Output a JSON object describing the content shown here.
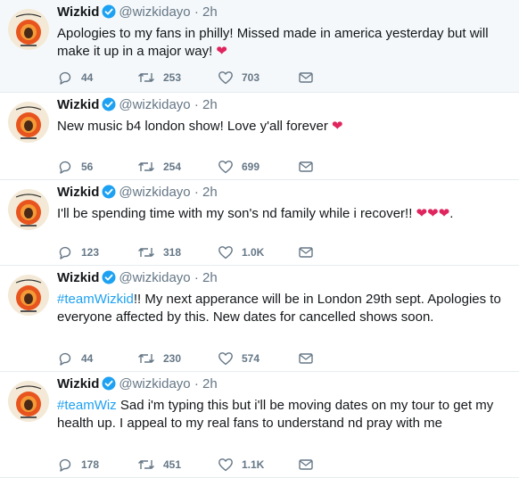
{
  "colors": {
    "link": "#1da1f2",
    "heart": "#e0245e",
    "muted": "#657786",
    "verified": "#1da1f2"
  },
  "tweets": [
    {
      "name": "Wizkid",
      "handle": "@wizkidayo",
      "sep": "·",
      "time": "2h",
      "hashtag": "",
      "text": "Apologies to my fans in philly! Missed made in america yesterday but will make it up in a major way! ",
      "emoji": "❤",
      "trailing": "",
      "reply_icon": "reply-icon",
      "retweet_icon": "retweet-icon",
      "like_icon": "heart-icon",
      "dm_icon": "envelope-icon",
      "replies": "44",
      "retweets": "253",
      "likes": "703"
    },
    {
      "name": "Wizkid",
      "handle": "@wizkidayo",
      "sep": "·",
      "time": "2h",
      "hashtag": "",
      "text": "New music b4 london show! Love y'all forever ",
      "emoji": "❤",
      "trailing": "",
      "replies": "56",
      "retweets": "254",
      "likes": "699"
    },
    {
      "name": "Wizkid",
      "handle": "@wizkidayo",
      "sep": "·",
      "time": "2h",
      "hashtag": "",
      "text": "I'll be spending time with my son's nd family while i recover!! ",
      "emoji": "❤❤❤",
      "trailing": ".",
      "replies": "123",
      "retweets": "318",
      "likes": "1.0K"
    },
    {
      "name": "Wizkid",
      "handle": "@wizkidayo",
      "sep": "·",
      "time": "2h",
      "hashtag": "#teamWizkid",
      "text": "!! My next apperance will be in London 29th sept. Apologies to everyone affected by this. New dates for cancelled shows soon.",
      "emoji": "",
      "trailing": "",
      "replies": "44",
      "retweets": "230",
      "likes": "574"
    },
    {
      "name": "Wizkid",
      "handle": "@wizkidayo",
      "sep": "·",
      "time": "2h",
      "hashtag": "#teamWiz",
      "text": " Sad i'm typing this but i'll be moving dates on my tour to get my health up. I appeal to my real fans to understand nd pray with me",
      "emoji": "",
      "trailing": "",
      "replies": "178",
      "retweets": "451",
      "likes": "1.1K"
    }
  ]
}
